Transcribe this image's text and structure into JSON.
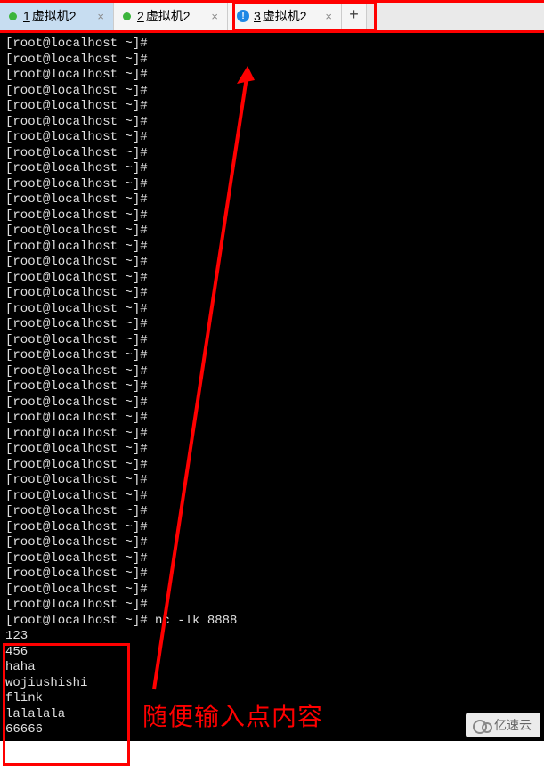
{
  "tabs": [
    {
      "num": "1",
      "label": "虚拟机2",
      "status": "green",
      "active": true
    },
    {
      "num": "2",
      "label": "虚拟机2",
      "status": "green",
      "active": false
    },
    {
      "num": "3",
      "label": "虚拟机2",
      "status": "info",
      "active": false
    }
  ],
  "terminal": {
    "prompt": "[root@localhost ~]#",
    "empty_prompt_count": 37,
    "command": "nc -lk 8888",
    "output_lines": [
      "123",
      "456",
      "haha",
      "wojiushishi",
      "flink",
      "lalalala",
      "66666"
    ]
  },
  "annotation": "随便输入点内容",
  "watermark": "亿速云"
}
